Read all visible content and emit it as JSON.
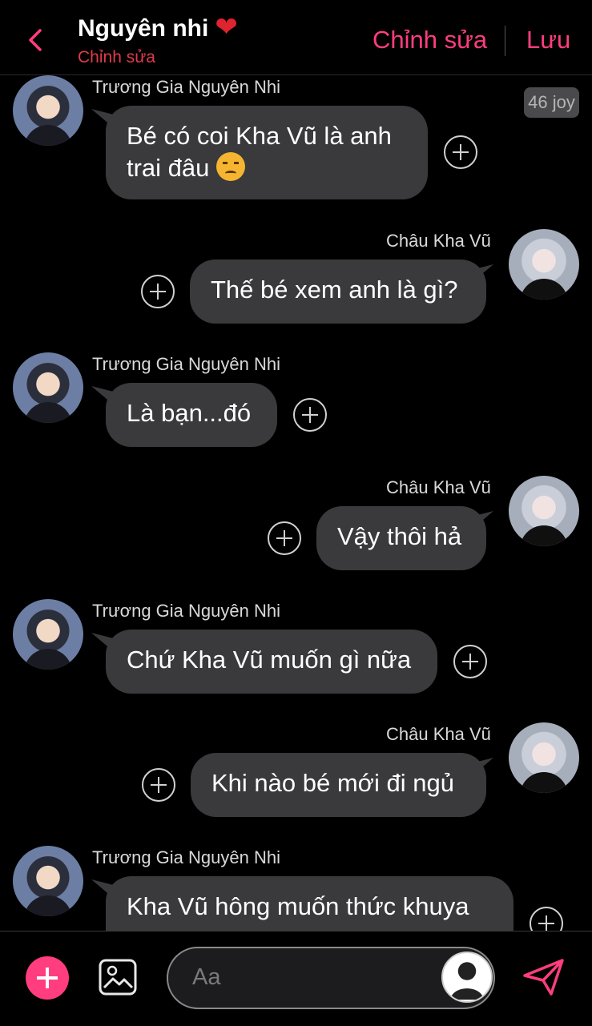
{
  "header": {
    "title": "Nguyên nhi",
    "heart": "❤",
    "subtitle": "Chỉnh sửa",
    "edit_label": "Chỉnh sửa",
    "save_label": "Lưu"
  },
  "joy_badge": "46 joy",
  "messages": [
    {
      "sender": "Trương Gia Nguyên Nhi",
      "side": "left",
      "text": "Bé có coi Kha Vũ là anh trai đâu"
    },
    {
      "sender": "Châu Kha Vũ",
      "side": "right",
      "text": "Thế bé xem anh là gì?"
    },
    {
      "sender": "Trương Gia Nguyên Nhi",
      "side": "left",
      "text": "Là bạn...đó"
    },
    {
      "sender": "Châu Kha Vũ",
      "side": "right",
      "text": "Vậy thôi hả"
    },
    {
      "sender": "Trương Gia Nguyên Nhi",
      "side": "left",
      "text": "Chứ Kha Vũ muốn gì nữa"
    },
    {
      "sender": "Châu Kha Vũ",
      "side": "right",
      "text": "Khi nào bé mới đi ngủ"
    },
    {
      "sender": "Trương Gia Nguyên Nhi",
      "side": "left",
      "text": "Kha Vũ hông muốn thức khuya"
    }
  ],
  "composer": {
    "placeholder": "Aa"
  },
  "colors": {
    "accent": "#ff3d7f",
    "bubble": "#3a3a3c",
    "background": "#000000"
  },
  "icons": [
    "chevron-left-icon",
    "heart-icon",
    "plus-circle-icon",
    "image-icon",
    "user-icon",
    "send-icon"
  ]
}
